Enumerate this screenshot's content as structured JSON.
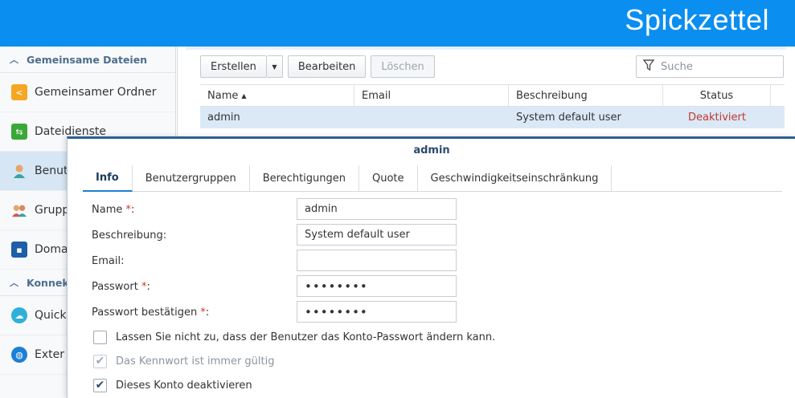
{
  "banner": {
    "title": "Spickzettel"
  },
  "sidebar": {
    "sections": [
      {
        "label": "Gemeinsame Dateien"
      },
      {
        "label": "Konnek"
      }
    ],
    "items": [
      {
        "label": "Gemeinsamer Ordner",
        "icon": "shared-folder-icon"
      },
      {
        "label": "Dateidienste",
        "icon": "file-services-icon"
      },
      {
        "label": "Benut",
        "icon": "user-icon"
      },
      {
        "label": "Grupp",
        "icon": "group-icon"
      },
      {
        "label": "Doma",
        "icon": "domain-icon"
      },
      {
        "label": "Quick",
        "icon": "quickconnect-icon"
      },
      {
        "label": "Exter",
        "icon": "external-access-icon"
      }
    ]
  },
  "toolbar": {
    "create_label": "Erstellen",
    "edit_label": "Bearbeiten",
    "delete_label": "Löschen",
    "search_placeholder": "Suche"
  },
  "table": {
    "columns": [
      "Name",
      "Email",
      "Beschreibung",
      "Status"
    ],
    "rows": [
      {
        "name": "admin",
        "email": "",
        "description": "System default user",
        "status": "Deaktiviert"
      }
    ]
  },
  "dialog": {
    "title": "admin",
    "tabs": [
      "Info",
      "Benutzergruppen",
      "Berechtigungen",
      "Quote",
      "Geschwindigkeitseinschränkung"
    ],
    "fields": {
      "name_label": "Name",
      "name_value": "admin",
      "description_label": "Beschreibung:",
      "description_value": "System default user",
      "email_label": "Email:",
      "email_value": "",
      "password_label": "Passwort",
      "password_value": "••••••••",
      "password_confirm_label": "Passwort bestätigen",
      "password_confirm_value": "••••••••",
      "required_mark": "*",
      "colon": ":"
    },
    "checkboxes": [
      {
        "label": "Lassen Sie nicht zu, dass der Benutzer das Konto-Passwort ändern kann.",
        "checked": false,
        "disabled": false
      },
      {
        "label": "Das Kennwort ist immer gültig",
        "checked": true,
        "disabled": true
      },
      {
        "label": "Dieses Konto deaktivieren",
        "checked": true,
        "disabled": false
      }
    ]
  },
  "colors": {
    "banner": "#0a8ef0",
    "accent": "#1e7fd6",
    "status_disabled": "#c0392b"
  }
}
